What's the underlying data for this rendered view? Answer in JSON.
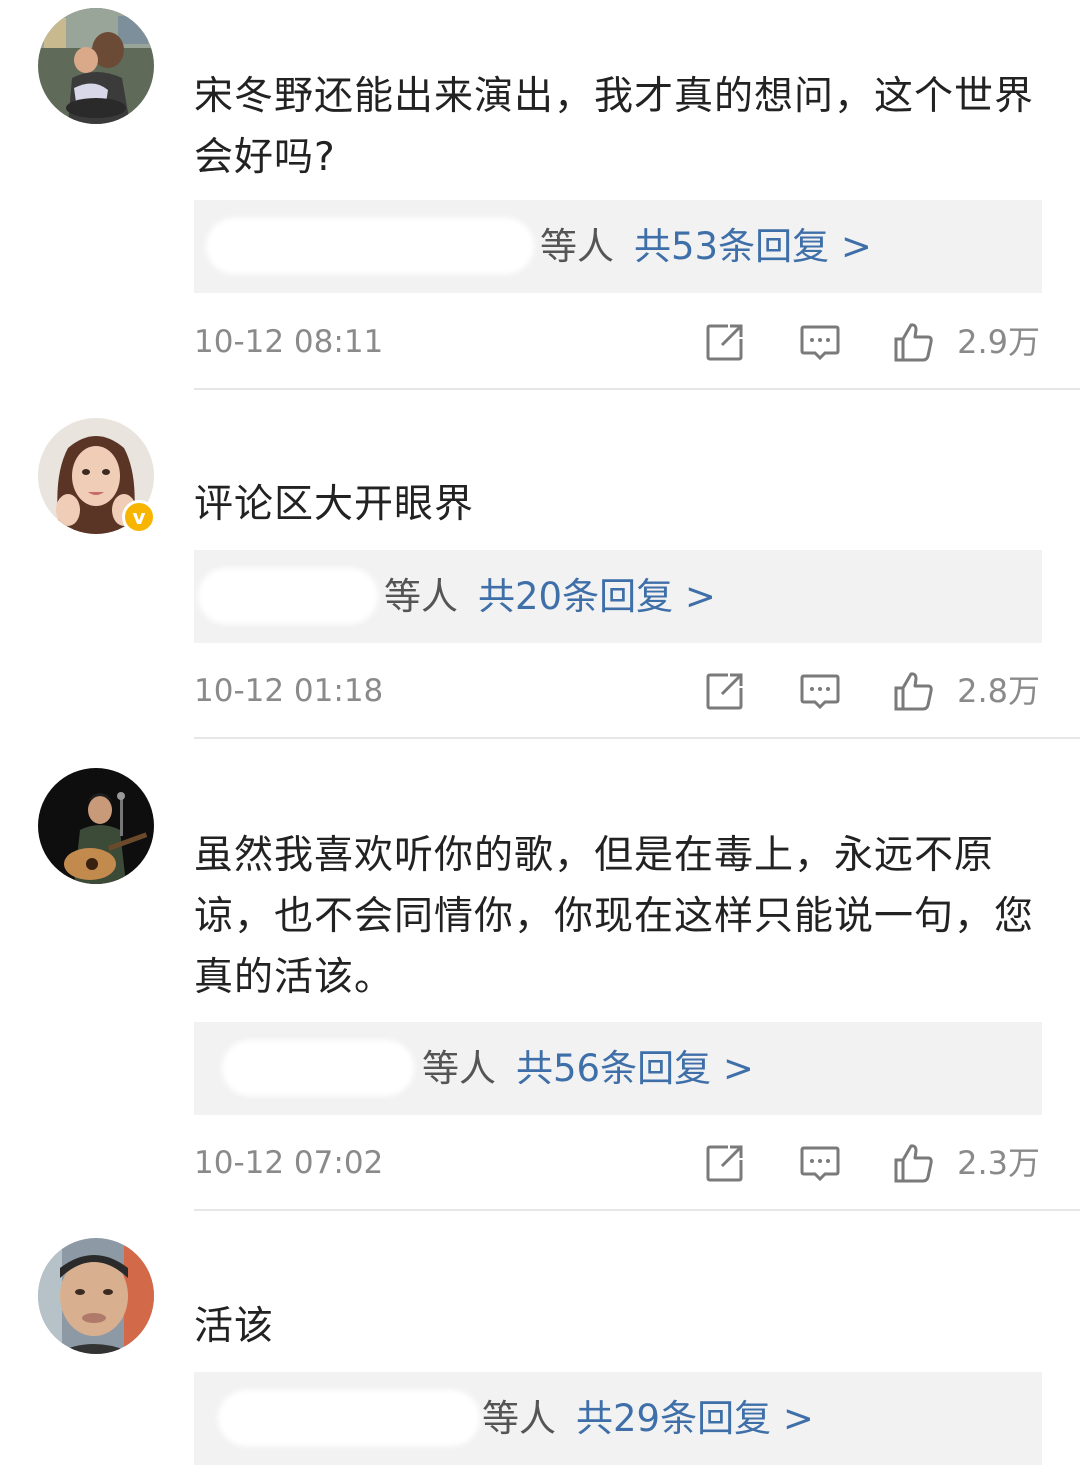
{
  "comments": [
    {
      "text": "宋冬野还能出来演出，我才真的想问，这个世界会好吗?",
      "reply_suffix": "等人",
      "reply_count": "共53条回复 >",
      "timestamp": "10-12 08:11",
      "likes": "2.9万",
      "verified": false
    },
    {
      "text": "评论区大开眼界",
      "reply_suffix": "等人",
      "reply_count": "共20条回复 >",
      "timestamp": "10-12 01:18",
      "likes": "2.8万",
      "verified": true,
      "verified_badge": "v"
    },
    {
      "text": "虽然我喜欢听你的歌，但是在毒上，永远不原谅，也不会同情你，你现在这样只能说一句，您真的活该。",
      "reply_suffix": "等人",
      "reply_count": "共56条回复 >",
      "timestamp": "10-12 07:02",
      "likes": "2.3万",
      "verified": false
    },
    {
      "text": "活该",
      "reply_suffix": "等人",
      "reply_count": "共29条回复 >",
      "verified": false
    }
  ],
  "icons": {
    "repost": "repost-icon",
    "comment": "comment-icon",
    "like": "thumbs-up-icon"
  },
  "colors": {
    "reply_link": "#3f6fa8",
    "meta_gray": "#8a8a8a",
    "reply_bg": "#f2f2f2",
    "verified_badge": "#f7b500"
  }
}
